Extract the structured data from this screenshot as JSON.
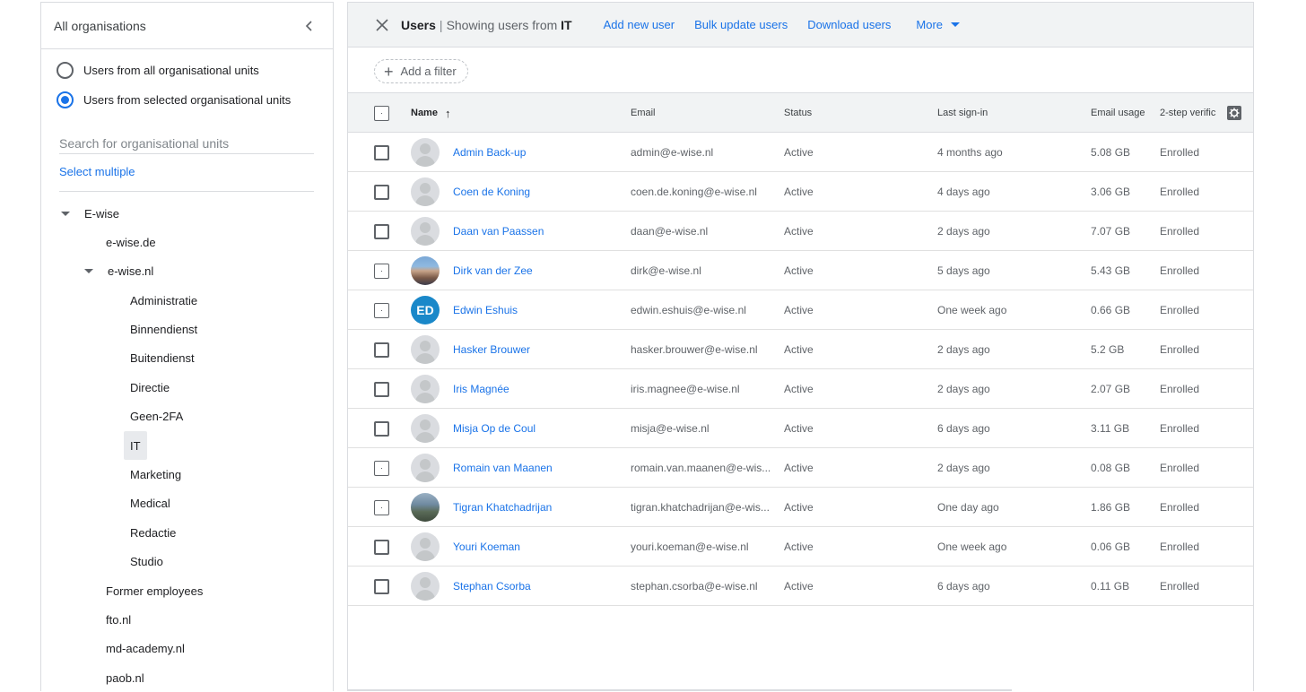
{
  "left_panel": {
    "title": "All organisations",
    "radio_all": "Users from all organisational units",
    "radio_selected": "Users from selected organisational units",
    "search_placeholder": "Search for organisational units",
    "select_multiple": "Select multiple",
    "tree": {
      "root": "E-wise",
      "child_de": "e-wise.de",
      "child_nl": "e-wise.nl",
      "units": [
        "Administratie",
        "Binnendienst",
        "Buitendienst",
        "Directie",
        "Geen-2FA",
        "IT",
        "Marketing",
        "Medical",
        "Redactie",
        "Studio"
      ],
      "other": [
        "Former employees",
        "fto.nl",
        "md-academy.nl",
        "paob.nl"
      ]
    }
  },
  "topbar": {
    "title": "Users",
    "separator": "|",
    "showing_prefix": "Showing users from",
    "showing_unit": "IT",
    "add_user": "Add new user",
    "bulk_update": "Bulk update users",
    "download": "Download users",
    "more": "More"
  },
  "filter": {
    "label": "Add a filter"
  },
  "table": {
    "headers": {
      "name": "Name",
      "email": "Email",
      "status": "Status",
      "last_signin": "Last sign-in",
      "email_usage": "Email usage",
      "two_step": "2-step verific"
    },
    "rows": [
      {
        "name": "Admin Back-up",
        "email": "admin@e-wise.nl",
        "status": "Active",
        "last": "4 months ago",
        "usage": "5.08 GB",
        "two_step": "Enrolled"
      },
      {
        "name": "Coen de Koning",
        "email": "coen.de.koning@e-wise.nl",
        "status": "Active",
        "last": "4 days ago",
        "usage": "3.06 GB",
        "two_step": "Enrolled"
      },
      {
        "name": "Daan van Paassen",
        "email": "daan@e-wise.nl",
        "status": "Active",
        "last": "2 days ago",
        "usage": "7.07 GB",
        "two_step": "Enrolled"
      },
      {
        "name": "Dirk van der Zee",
        "email": "dirk@e-wise.nl",
        "status": "Active",
        "last": "5 days ago",
        "usage": "5.43 GB",
        "two_step": "Enrolled"
      },
      {
        "name": "Edwin Eshuis",
        "email": "edwin.eshuis@e-wise.nl",
        "status": "Active",
        "last": "One week ago",
        "usage": "0.66 GB",
        "two_step": "Enrolled",
        "initials": "ED"
      },
      {
        "name": "Hasker Brouwer",
        "email": "hasker.brouwer@e-wise.nl",
        "status": "Active",
        "last": "2 days ago",
        "usage": "5.2 GB",
        "two_step": "Enrolled"
      },
      {
        "name": "Iris Magnée",
        "email": "iris.magnee@e-wise.nl",
        "status": "Active",
        "last": "2 days ago",
        "usage": "2.07 GB",
        "two_step": "Enrolled"
      },
      {
        "name": "Misja Op de Coul",
        "email": "misja@e-wise.nl",
        "status": "Active",
        "last": "6 days ago",
        "usage": "3.11 GB",
        "two_step": "Enrolled"
      },
      {
        "name": "Romain van Maanen",
        "email": "romain.van.maanen@e-wis...",
        "status": "Active",
        "last": "2 days ago",
        "usage": "0.08 GB",
        "two_step": "Enrolled"
      },
      {
        "name": "Tigran Khatchadrijan",
        "email": "tigran.khatchadrijan@e-wis...",
        "status": "Active",
        "last": "One day ago",
        "usage": "1.86 GB",
        "two_step": "Enrolled"
      },
      {
        "name": "Youri Koeman",
        "email": "youri.koeman@e-wise.nl",
        "status": "Active",
        "last": "One week ago",
        "usage": "0.06 GB",
        "two_step": "Enrolled"
      },
      {
        "name": "Stephan Csorba",
        "email": "stephan.csorba@e-wise.nl",
        "status": "Active",
        "last": "6 days ago",
        "usage": "0.11 GB",
        "two_step": "Enrolled"
      }
    ]
  },
  "colors": {
    "accent": "#1a73e8",
    "header_bg": "#f1f3f4",
    "border": "#dadce0"
  }
}
